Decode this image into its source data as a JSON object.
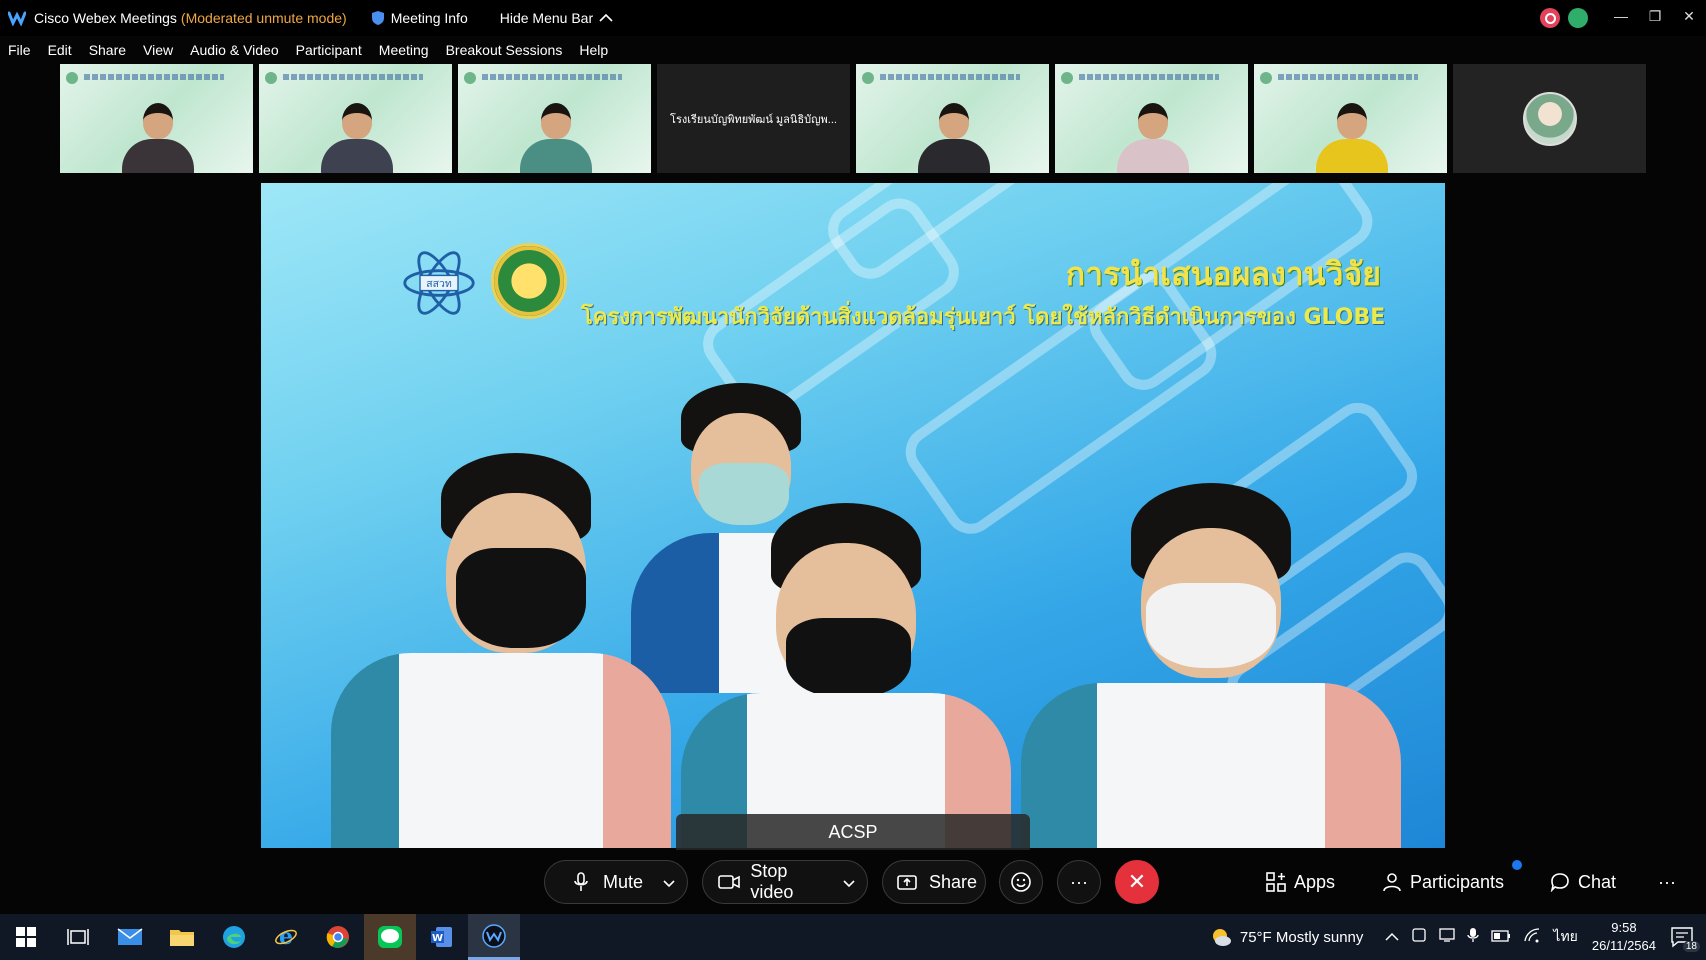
{
  "window": {
    "app_title": "Cisco Webex Meetings",
    "mode": "(Moderated unmute mode)",
    "meeting_info": "Meeting Info",
    "hide_menu_bar": "Hide Menu Bar",
    "minimize": "—",
    "restore": "❐",
    "close": "✕"
  },
  "menu": [
    "File",
    "Edit",
    "Share",
    "View",
    "Audio & Video",
    "Participant",
    "Meeting",
    "Breakout Sessions",
    "Help"
  ],
  "thumbnails": {
    "dark_tile_name": "โรงเรียนบัญพิทยพัฒน์ มูลนิธิบัญพ..."
  },
  "slide": {
    "title": "การนำเสนอผลงานวิจัย",
    "subtitle": "โครงการพัฒนานักวิจัยด้านสิ่งแวดล้อมรุ่นเยาว์ โดยใช้หลักวิธีดำเนินการของ GLOBE",
    "logo_text": "สสวท"
  },
  "active_speaker": "ACSP",
  "controls": {
    "mute": "Mute",
    "stop_video": "Stop video",
    "share": "Share",
    "more": "···",
    "end": "✕",
    "apps": "Apps",
    "participants": "Participants",
    "chat": "Chat",
    "overflow": "···"
  },
  "taskbar": {
    "weather": "75°F  Mostly sunny",
    "language": "ไทย",
    "time": "9:58",
    "date": "26/11/2564",
    "notification_count": "18"
  },
  "colors": {
    "mode_text": "#f0a742",
    "end_button": "#e4313c",
    "slide_title": "#f3e34a",
    "notification_dot": "#1c78f0"
  }
}
